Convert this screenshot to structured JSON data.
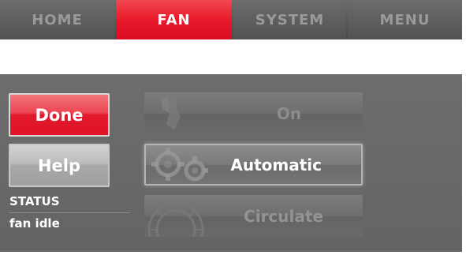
{
  "tabs": [
    {
      "label": "HOME",
      "active": false
    },
    {
      "label": "FAN",
      "active": true
    },
    {
      "label": "SYSTEM",
      "active": false
    },
    {
      "label": "MENU",
      "active": false
    }
  ],
  "side_buttons": {
    "done_label": "Done",
    "help_label": "Help"
  },
  "status": {
    "label": "STATUS",
    "value": "fan idle"
  },
  "fan_options": [
    {
      "label": "On",
      "selected": false,
      "icon": "fan-blade-icon"
    },
    {
      "label": "Automatic",
      "selected": true,
      "icon": "gears-icon"
    },
    {
      "label": "Circulate",
      "selected": false,
      "icon": "circulate-wheel-icon"
    }
  ],
  "colors": {
    "accent_red": "#e8192b",
    "panel_gray": "#686868",
    "text_white": "#ffffff"
  }
}
